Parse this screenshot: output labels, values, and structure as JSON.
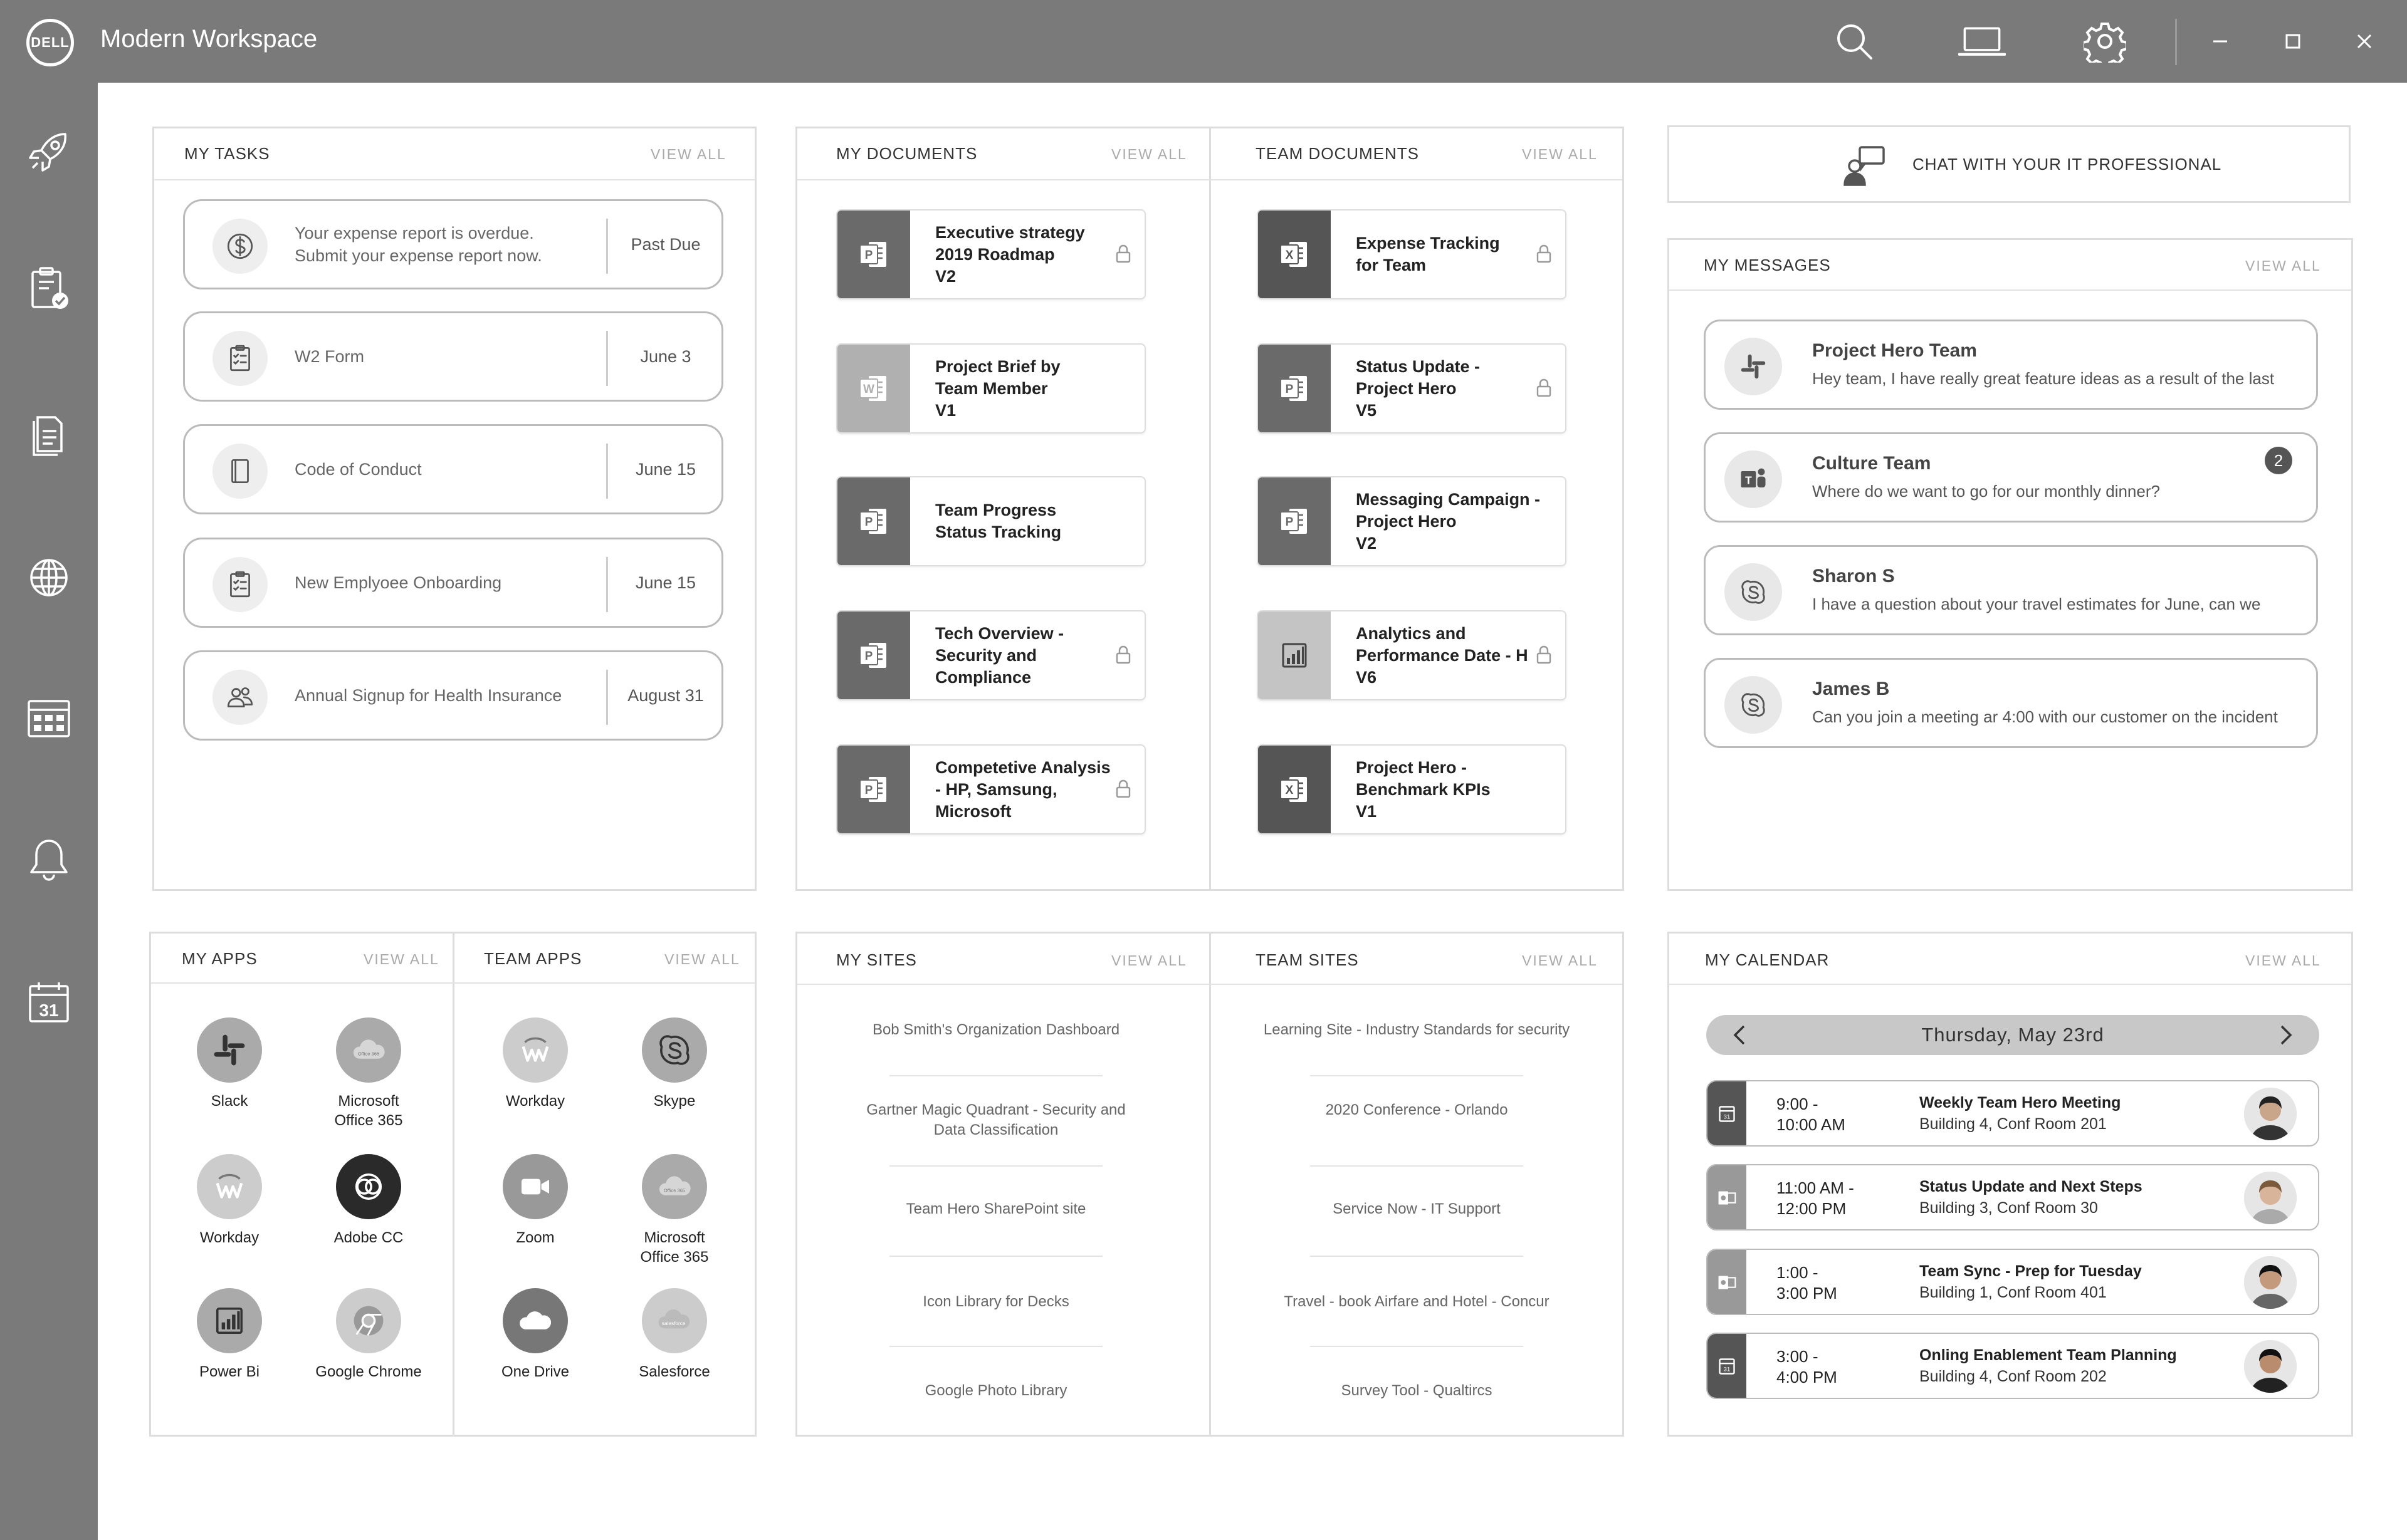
{
  "app": {
    "title": "Modern Workspace",
    "logo_text": "DELL"
  },
  "sections": {
    "my_tasks": {
      "title": "MY TASKS",
      "view_all": "VIEW ALL"
    },
    "my_documents": {
      "title": "MY DOCUMENTS",
      "view_all": "VIEW ALL"
    },
    "team_documents": {
      "title": "TEAM DOCUMENTS",
      "view_all": "VIEW ALL"
    },
    "chat": {
      "label": "CHAT WITH YOUR IT PROFESSIONAL"
    },
    "my_messages": {
      "title": "MY MESSAGES",
      "view_all": "VIEW ALL"
    },
    "my_apps": {
      "title": "MY APPS",
      "view_all": "VIEW ALL"
    },
    "team_apps": {
      "title": "TEAM APPS",
      "view_all": "VIEW ALL"
    },
    "my_sites": {
      "title": "MY SITES",
      "view_all": "VIEW ALL"
    },
    "team_sites": {
      "title": "TEAM SITES",
      "view_all": "VIEW ALL"
    },
    "my_calendar": {
      "title": "MY CALENDAR",
      "view_all": "VIEW ALL"
    }
  },
  "tasks": [
    {
      "text": "Your expense report is overdue.\nSubmit your expense report now.",
      "due": "Past Due",
      "icon": "dollar-icon"
    },
    {
      "text": "W2 Form",
      "due": "June 3",
      "icon": "checklist-icon"
    },
    {
      "text": "Code of Conduct",
      "due": "June 15",
      "icon": "book-icon"
    },
    {
      "text": "New Emplyoee Onboarding",
      "due": "June 15",
      "icon": "checklist-icon"
    },
    {
      "text": "Annual Signup for Health Insurance",
      "due": "August 31",
      "icon": "users-icon"
    }
  ],
  "my_documents": [
    {
      "title": "Executive strategy\n2019 Roadmap\nV2",
      "type": "P",
      "locked": true
    },
    {
      "title": "Project Brief by\nTeam Member\nV1",
      "type": "W",
      "locked": false
    },
    {
      "title": "Team Progress\nStatus Tracking",
      "type": "P",
      "locked": false
    },
    {
      "title": "Tech Overview -\nSecurity and\nCompliance",
      "type": "P",
      "locked": true
    },
    {
      "title": "Competetive Analysis\n- HP, Samsung,\nMicrosoft",
      "type": "P",
      "locked": true
    }
  ],
  "team_documents": [
    {
      "title": "Expense Tracking\nfor Team",
      "type": "X",
      "locked": true
    },
    {
      "title": "Status Update -\nProject Hero\nV5",
      "type": "P",
      "locked": true
    },
    {
      "title": "Messaging Campaign -\nProject Hero\nV2",
      "type": "P",
      "locked": false
    },
    {
      "title": "Analytics and\nPerformance Date - H\nV6",
      "type": "BI",
      "locked": true
    },
    {
      "title": "Project Hero -\nBenchmark KPIs\nV1",
      "type": "X",
      "locked": false
    }
  ],
  "messages": [
    {
      "name": "Project Hero Team",
      "text": "Hey team, I have really great feature ideas as a result of the last",
      "icon": "slack-icon",
      "badge": ""
    },
    {
      "name": "Culture Team",
      "text": "Where do we want to go for our monthly dinner?",
      "icon": "teams-icon",
      "badge": "2"
    },
    {
      "name": "Sharon S",
      "text": "I have a question about your travel estimates for June, can we",
      "icon": "skype-icon",
      "badge": ""
    },
    {
      "name": "James B",
      "text": "Can you join a meeting ar 4:00 with our customer on the incident",
      "icon": "skype-icon",
      "badge": ""
    }
  ],
  "my_apps": [
    {
      "label": "Slack",
      "icon": "slack-icon"
    },
    {
      "label": "Microsoft\nOffice 365",
      "icon": "office-icon"
    },
    {
      "label": "Workday",
      "icon": "workday-icon"
    },
    {
      "label": "Adobe CC",
      "icon": "adobe-cc-icon"
    },
    {
      "label": "Power Bi",
      "icon": "power-bi-icon"
    },
    {
      "label": "Google Chrome",
      "icon": "chrome-icon"
    }
  ],
  "team_apps": [
    {
      "label": "Workday",
      "icon": "workday-icon"
    },
    {
      "label": "Skype",
      "icon": "skype-icon"
    },
    {
      "label": "Zoom",
      "icon": "zoom-icon"
    },
    {
      "label": "Microsoft\nOffice 365",
      "icon": "office-icon"
    },
    {
      "label": "One Drive",
      "icon": "onedrive-icon"
    },
    {
      "label": "Salesforce",
      "icon": "salesforce-icon"
    }
  ],
  "office_badge": "Office 365",
  "salesforce_badge": "salesforce",
  "my_sites": [
    "Bob Smith's Organization Dashboard",
    "Gartner Magic Quadrant - Security and\nData Classification",
    "Team Hero SharePoint site",
    "Icon Library for Decks",
    "Google Photo Library"
  ],
  "team_sites": [
    "Learning Site - Industry Standards for security",
    "2020 Conference - Orlando",
    "Service Now - IT Support",
    "Travel - book Airfare and Hotel - Concur",
    "Survey Tool - Qualtircs"
  ],
  "calendar": {
    "date": "Thursday, May 23rd",
    "events": [
      {
        "time": "9:00 -\n10:00 AM",
        "title": "Weekly Team Hero Meeting",
        "location": "Building 4, Conf Room 201",
        "icon": "calendar-icon",
        "shade": "#555555"
      },
      {
        "time": "11:00 AM -\n12:00 PM",
        "title": "Status Update and Next Steps",
        "location": "Building 3, Conf Room 30",
        "icon": "outlook-icon",
        "shade": "#999999"
      },
      {
        "time": "1:00 -\n3:00 PM",
        "title": "Team Sync - Prep for Tuesday",
        "location": "Building 1, Conf Room 401",
        "icon": "outlook-icon",
        "shade": "#999999"
      },
      {
        "time": "3:00 -\n4:00 PM",
        "title": "Onling Enablement Team Planning",
        "location": "Building 4, Conf Room 202",
        "icon": "calendar-icon",
        "shade": "#555555"
      }
    ]
  },
  "sidebar": [
    "rocket-icon",
    "clipboard-check-icon",
    "documents-icon",
    "globe-icon",
    "apps-grid-icon",
    "bell-icon",
    "calendar-icon"
  ],
  "calendar_icon_number": "31",
  "colors": {
    "chrome": "#7a7a7a",
    "border": "#dddddd"
  }
}
